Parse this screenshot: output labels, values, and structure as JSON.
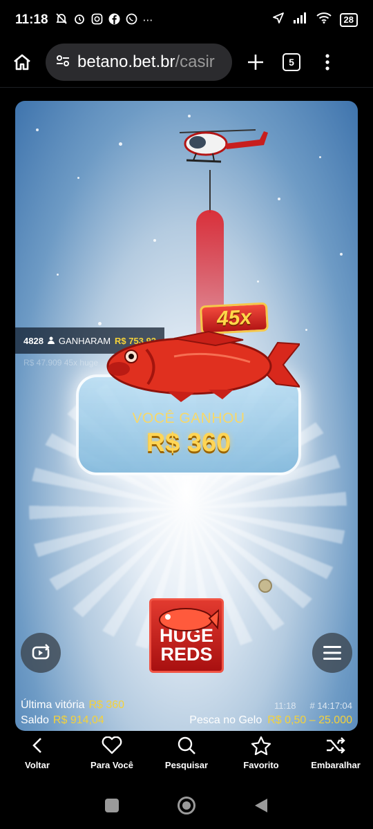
{
  "status_bar": {
    "time": "11:18",
    "battery": "28"
  },
  "browser": {
    "url_host": "betano.bet.br",
    "url_path": "/casir",
    "tabs_count": "5"
  },
  "game": {
    "winners_count": "4828",
    "winners_label": "GANHARAM",
    "winners_amount": "R$ 753.92",
    "ghost_text": "R$ 47.909  45x  huge",
    "multiplier": "45x",
    "win_label": "VOCÊ GANHOU",
    "win_amount": "R$ 360",
    "logo_line1": "HUGE",
    "logo_line2": "REDS",
    "footer": {
      "last_win_label": "Última vitória",
      "last_win_value": "R$ 360",
      "balance_label": "Saldo",
      "balance_value": "R$ 914,04",
      "clock": "11:18",
      "round_id": "# 14:17:04",
      "game_name": "Pesca no Gelo",
      "bet_range": "R$ 0,50 – 25.000"
    }
  },
  "bottom_nav": {
    "items": [
      {
        "label": "Voltar",
        "icon": "chevron-left-icon"
      },
      {
        "label": "Para Você",
        "icon": "heart-icon"
      },
      {
        "label": "Pesquisar",
        "icon": "search-icon"
      },
      {
        "label": "Favorito",
        "icon": "star-icon"
      },
      {
        "label": "Embaralhar",
        "icon": "shuffle-icon"
      }
    ]
  },
  "colors": {
    "accent_yellow": "#f5d23a",
    "brand_red": "#d0241c"
  }
}
